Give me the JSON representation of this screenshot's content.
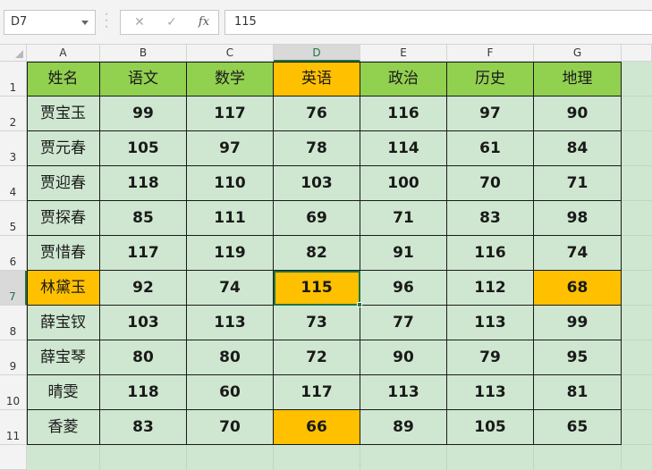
{
  "formula_bar": {
    "name_box": "D7",
    "cancel_icon": "✕",
    "enter_icon": "✓",
    "fx_label": "fx",
    "formula": "115"
  },
  "columns": [
    "A",
    "B",
    "C",
    "D",
    "E",
    "F",
    "G"
  ],
  "rows": [
    "1",
    "2",
    "3",
    "4",
    "5",
    "6",
    "7",
    "8",
    "9",
    "10",
    "11"
  ],
  "selected_column": "D",
  "selected_row": "7",
  "table": {
    "headers": [
      "姓名",
      "语文",
      "数学",
      "英语",
      "政治",
      "历史",
      "地理"
    ],
    "rows": [
      [
        "贾宝玉",
        "99",
        "117",
        "76",
        "116",
        "97",
        "90"
      ],
      [
        "贾元春",
        "105",
        "97",
        "78",
        "114",
        "61",
        "84"
      ],
      [
        "贾迎春",
        "118",
        "110",
        "103",
        "100",
        "70",
        "71"
      ],
      [
        "贾探春",
        "85",
        "111",
        "69",
        "71",
        "83",
        "98"
      ],
      [
        "贾惜春",
        "117",
        "119",
        "82",
        "91",
        "116",
        "74"
      ],
      [
        "林黛玉",
        "92",
        "74",
        "115",
        "96",
        "112",
        "68"
      ],
      [
        "薛宝钗",
        "103",
        "113",
        "73",
        "77",
        "113",
        "99"
      ],
      [
        "薛宝琴",
        "80",
        "80",
        "72",
        "90",
        "79",
        "95"
      ],
      [
        "晴雯",
        "118",
        "60",
        "117",
        "113",
        "113",
        "81"
      ],
      [
        "香菱",
        "83",
        "70",
        "66",
        "89",
        "105",
        "65"
      ]
    ],
    "highlighted_cells": [
      "D1",
      "A7",
      "D7",
      "G7",
      "D11"
    ],
    "active_cell": "D7"
  },
  "colors": {
    "header_fill": "#92d050",
    "highlight_fill": "#ffc000",
    "sheet_fill": "#cfe7d0",
    "accent": "#217346"
  }
}
